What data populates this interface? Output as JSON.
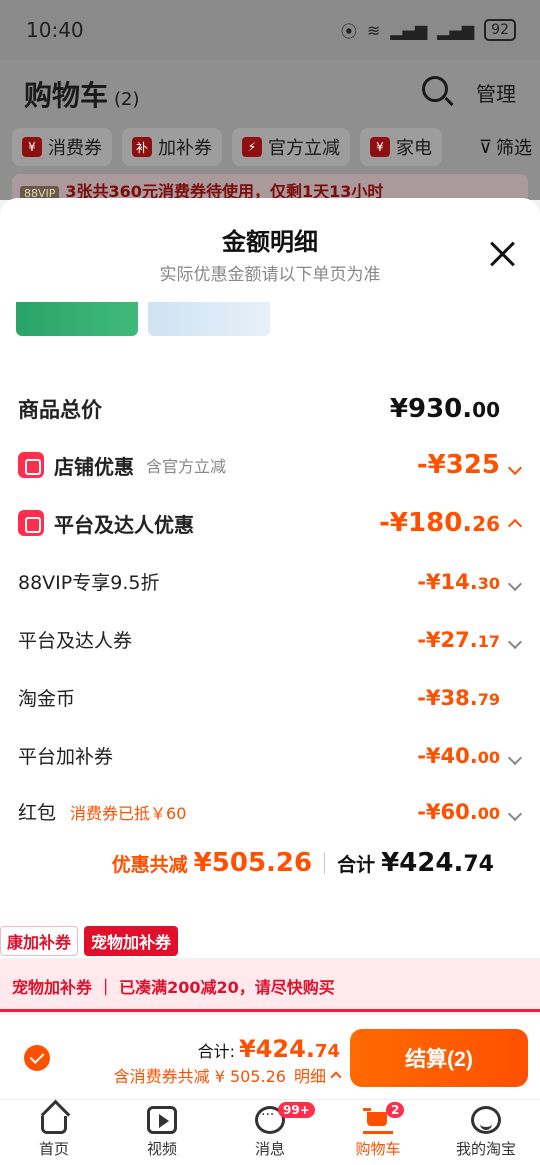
{
  "status": {
    "time": "10:40",
    "battery": "92"
  },
  "cart_header": {
    "title": "购物车",
    "count": "(2)",
    "manage": "管理",
    "chips": [
      "消费券",
      "加补券",
      "官方立减",
      "家电"
    ],
    "chip_icons": [
      "¥",
      "补",
      "⚡",
      "¥"
    ],
    "filter": "筛选",
    "vip_tag": "88VIP",
    "vip_text": "3张共360元消费券待使用，仅剩1天13小时"
  },
  "sheet": {
    "title": "金额明细",
    "subtitle": "实际优惠金额请以下单页为准",
    "total_label": "商品总价",
    "total_int": "¥930.",
    "total_dec": "00",
    "shop_label": "店铺优惠",
    "shop_note": "含官方立减",
    "shop_int": "-¥325",
    "shop_dec": "",
    "platform_label": "平台及达人优惠",
    "platform_int": "-¥180.",
    "platform_dec": "26",
    "items": [
      {
        "label": "88VIP专享9.5折",
        "note": "",
        "int": "-¥14.",
        "dec": "30"
      },
      {
        "label": "平台及达人券",
        "note": "",
        "int": "-¥27.",
        "dec": "17"
      },
      {
        "label": "淘金币",
        "note": "",
        "int": "-¥38.",
        "dec": "79"
      },
      {
        "label": "平台加补券",
        "note": "",
        "int": "-¥40.",
        "dec": "00"
      },
      {
        "label": "红包",
        "note": "消费券已抵￥60",
        "int": "-¥60.",
        "dec": "00"
      }
    ],
    "discount_label": "优惠共减",
    "discount_int": "¥505.",
    "discount_dec": "26",
    "sum_label": "合计",
    "sum_int": "¥424.",
    "sum_dec": "74"
  },
  "below": {
    "tag_a": "康加补券",
    "tag_b": "宠物加补券",
    "promo": "宠物加补券 ｜ 已凑满200减20，请尽快购买"
  },
  "checkout": {
    "total_label": "合计:",
    "total_int": "¥424.",
    "total_dec": "74",
    "sub": "含消费券共减 ¥ 505.26",
    "detail": "明细",
    "button": "结算(2)"
  },
  "tabbar": {
    "items": [
      {
        "label": "首页",
        "badge": ""
      },
      {
        "label": "视频",
        "badge": ""
      },
      {
        "label": "消息",
        "badge": "99+"
      },
      {
        "label": "购物车",
        "badge": "2"
      },
      {
        "label": "我的淘宝",
        "badge": ""
      }
    ]
  },
  "colors": {
    "accent": "#ff5000",
    "red": "#ff2e4d",
    "promo_red": "#e0102c"
  }
}
